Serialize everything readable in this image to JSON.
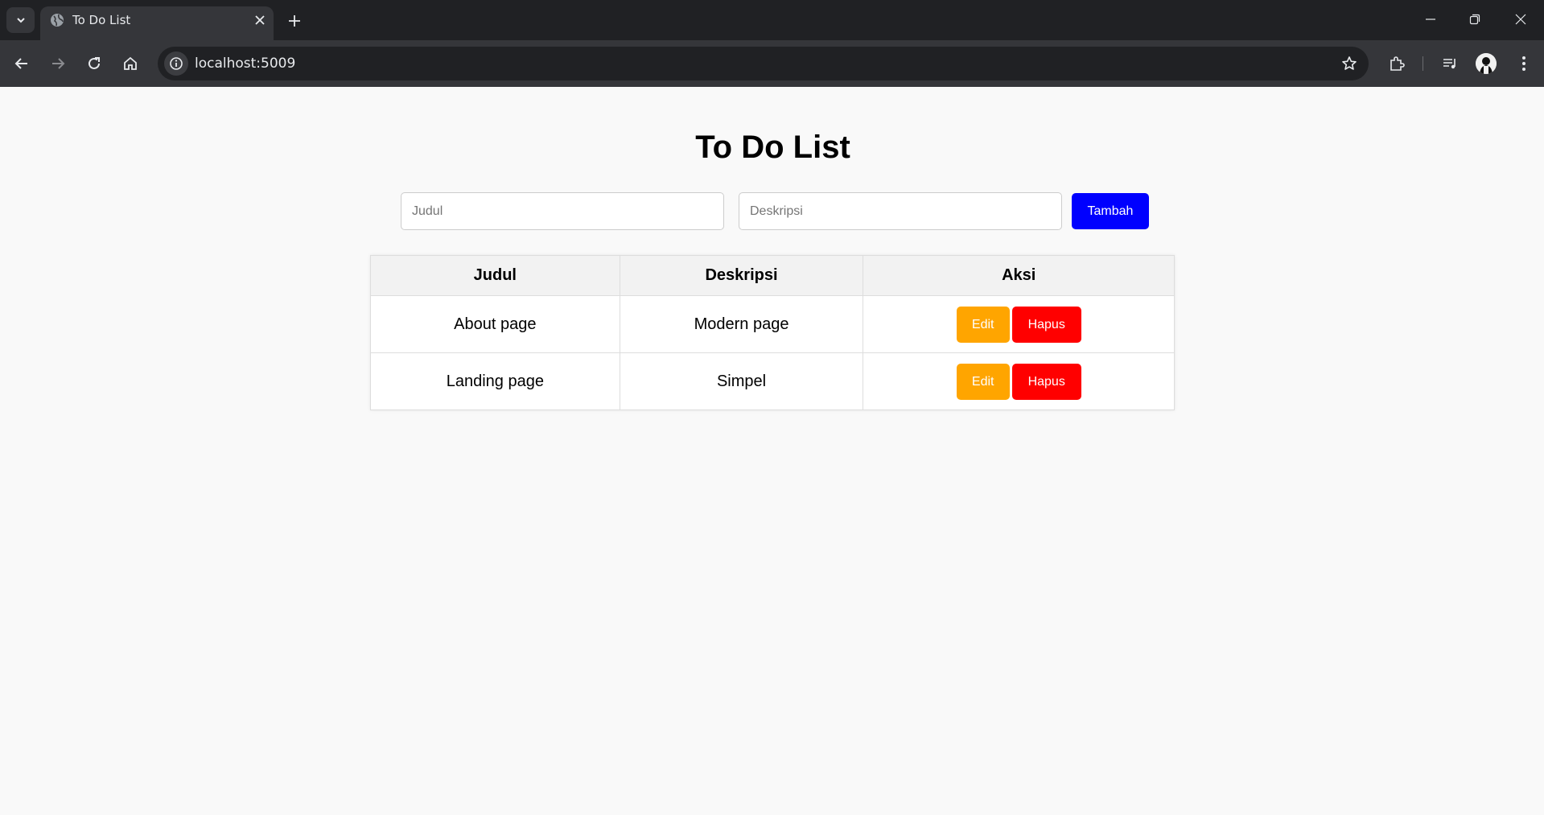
{
  "browser": {
    "tab_title": "To Do List",
    "url": "localhost:5009"
  },
  "page": {
    "title": "To Do List",
    "form": {
      "title_placeholder": "Judul",
      "title_value": "",
      "description_placeholder": "Deskripsi",
      "description_value": "",
      "add_label": "Tambah"
    },
    "table": {
      "headers": [
        "Judul",
        "Deskripsi",
        "Aksi"
      ],
      "rows": [
        {
          "title": "About page",
          "description": "Modern page",
          "edit_label": "Edit",
          "delete_label": "Hapus"
        },
        {
          "title": "Landing page",
          "description": "Simpel",
          "edit_label": "Edit",
          "delete_label": "Hapus"
        }
      ]
    }
  },
  "colors": {
    "add_button": "#0000ff",
    "edit_button": "#ffa500",
    "delete_button": "#ff0000",
    "page_background": "#f9f9f9",
    "browser_frame": "#202124"
  },
  "icons": [
    "tab-list-icon",
    "globe-icon",
    "close-icon",
    "plus-icon",
    "minimize-icon",
    "restore-icon",
    "window-close-icon",
    "back-icon",
    "forward-icon",
    "reload-icon",
    "home-icon",
    "site-info-icon",
    "star-icon",
    "extensions-icon",
    "media-icon",
    "avatar-icon",
    "menu-icon"
  ]
}
